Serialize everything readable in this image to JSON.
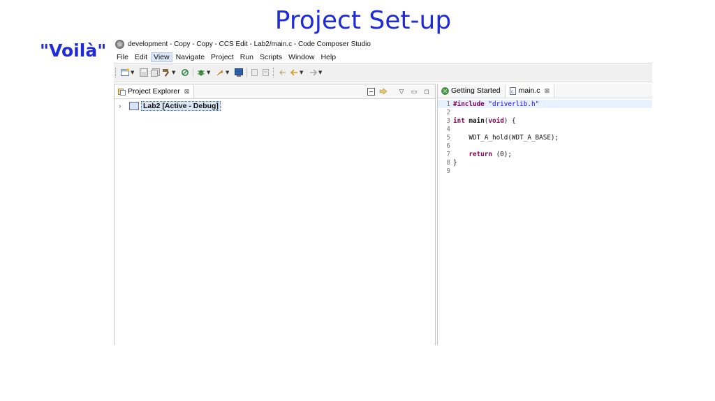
{
  "slide": {
    "title": "Project Set-up",
    "callout": "\"Voilà\""
  },
  "window": {
    "title": "development - Copy - Copy - CCS Edit - Lab2/main.c - Code Composer Studio"
  },
  "menu": [
    "File",
    "Edit",
    "View",
    "Navigate",
    "Project",
    "Run",
    "Scripts",
    "Window",
    "Help"
  ],
  "menu_active": "View",
  "toolbar": {
    "icons": [
      "new-icon",
      "save-icon",
      "save-all-icon",
      "build-hammer-icon",
      "refresh-icon",
      "debug-bug-icon",
      "flash-icon",
      "terminal-icon",
      "prev-annotation-icon",
      "next-annotation-icon",
      "last-edit-icon",
      "back-arrow-icon",
      "forward-arrow-icon"
    ]
  },
  "project_explorer": {
    "tab_label": "Project Explorer",
    "tab_close": "⊠",
    "project": "Lab2  [Active - Debug]"
  },
  "editor": {
    "tabs": [
      {
        "label": "Getting Started",
        "active": false
      },
      {
        "label": "main.c",
        "active": true,
        "close": "⊠"
      }
    ],
    "lines": [
      {
        "n": "1",
        "text": "#include \"driverlib.h\""
      },
      {
        "n": "2",
        "text": ""
      },
      {
        "n": "3",
        "text": "int main(void) {"
      },
      {
        "n": "4",
        "text": ""
      },
      {
        "n": "5",
        "text": "    WDT_A_hold(WDT_A_BASE);"
      },
      {
        "n": "6",
        "text": ""
      },
      {
        "n": "7",
        "text": "    return (0);"
      },
      {
        "n": "8",
        "text": "}"
      },
      {
        "n": "9",
        "text": ""
      }
    ]
  },
  "colors": {
    "slide_text": "#1f2bd8",
    "keyword": "#7f0055",
    "string": "#2a00ff"
  }
}
